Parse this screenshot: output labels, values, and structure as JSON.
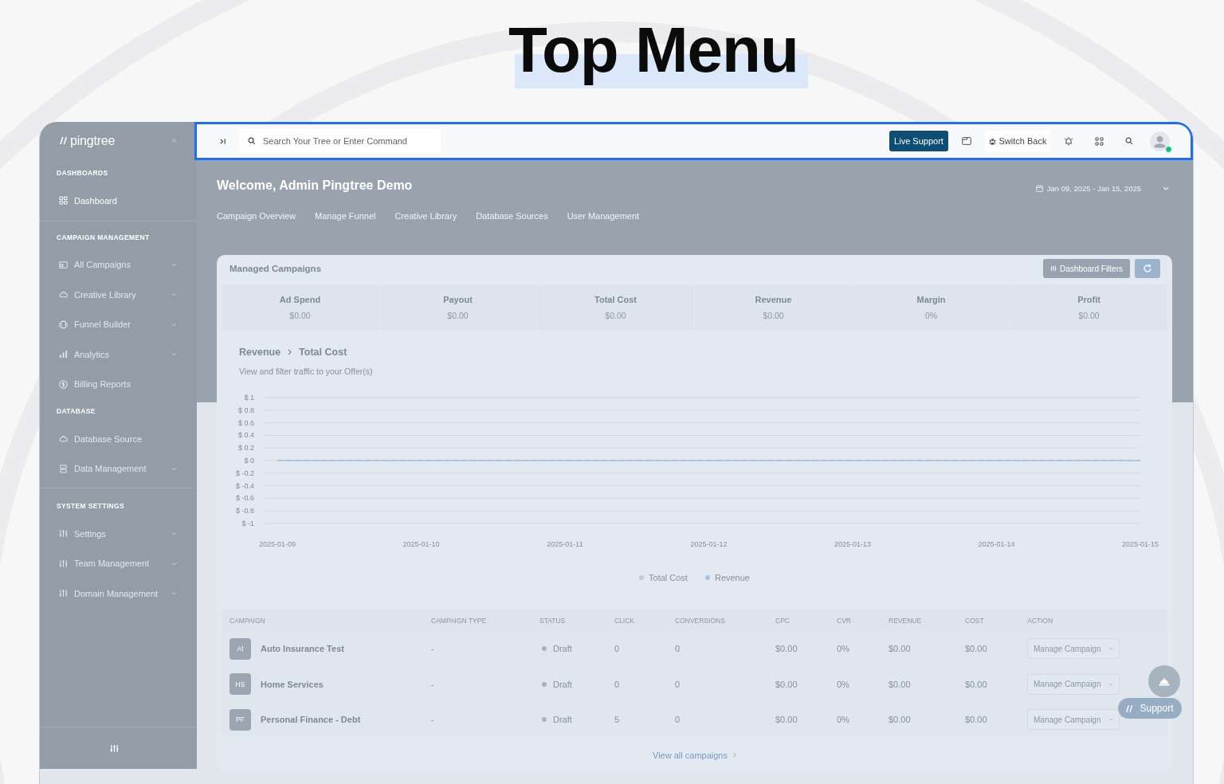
{
  "title": {
    "text": "Top Menu"
  },
  "sidebar": {
    "logo": "pingtree",
    "sections": [
      {
        "heading": "DASHBOARDS",
        "items": [
          {
            "label": "Dashboard",
            "kind": "link",
            "selected": true
          }
        ]
      },
      {
        "heading": "CAMPAIGN MANAGEMENT",
        "items": [
          {
            "label": "All Campaigns",
            "kind": "menu",
            "selected": false
          },
          {
            "label": "Creative Library",
            "kind": "menu",
            "selected": false
          },
          {
            "label": "Funnel Builder",
            "kind": "menu",
            "selected": false
          },
          {
            "label": "Analytics",
            "kind": "menu",
            "selected": false
          },
          {
            "label": "Billing Reports",
            "kind": "link",
            "selected": false
          }
        ]
      },
      {
        "heading": "DATABASE",
        "items": [
          {
            "label": "Database Source",
            "kind": "link",
            "selected": false
          },
          {
            "label": "Data Management",
            "kind": "menu",
            "selected": false
          }
        ]
      },
      {
        "heading": "SYSTEM SETTINGS",
        "items": [
          {
            "label": "Settings",
            "kind": "menu",
            "selected": false
          },
          {
            "label": "Team Management",
            "kind": "menu",
            "selected": false
          },
          {
            "label": "Domain Management",
            "kind": "menu",
            "selected": false
          }
        ]
      }
    ]
  },
  "topbar": {
    "search": {
      "placeholder": "Search Your Tree or Enter Command"
    },
    "live_support_button": "Live Support",
    "switch_back_button": "Switch Back",
    "user": {
      "online": true
    }
  },
  "header": {
    "greeting": "Welcome, Admin Pingtree Demo",
    "date_range": "Jan 09, 2025 - Jan 15, 2025",
    "tabs": [
      "Campaign Overview",
      "Manage Funnel",
      "Creative Library",
      "Database Sources",
      "User Management"
    ]
  },
  "managed_campaigns": {
    "title": "Managed Campaigns",
    "filters_button": "Dashboard Filters",
    "stats": [
      {
        "label": "Ad Spend",
        "value": "$0.00"
      },
      {
        "label": "Payout",
        "value": "$0.00"
      },
      {
        "label": "Total Cost",
        "value": "$0.00"
      },
      {
        "label": "Revenue",
        "value": "$0.00"
      },
      {
        "label": "Margin",
        "value": "0%"
      },
      {
        "label": "Profit",
        "value": "$0.00"
      }
    ],
    "chart": {
      "breadcrumb": [
        "Revenue",
        "Total Cost"
      ],
      "subtitle": "View and filter traffic to your Offer(s)",
      "chart_data": {
        "type": "line",
        "categories": [
          "2025-01-09",
          "2025-01-10",
          "2025-01-11",
          "2025-01-12",
          "2025-01-13",
          "2025-01-14",
          "2025-01-15"
        ],
        "series": [
          {
            "name": "Total Cost",
            "color": "#c3c9cf",
            "line_style": "solid",
            "values": [
              0,
              0,
              0,
              0,
              0,
              0,
              0
            ]
          },
          {
            "name": "Revenue",
            "color": "#a9c2e6",
            "line_style": "dashed",
            "values": [
              0,
              0,
              0,
              0,
              0,
              0,
              0
            ]
          }
        ],
        "ylim": [
          -1,
          1
        ],
        "yticks": [
          {
            "value": 1,
            "label": "$ 1"
          },
          {
            "value": 0.8,
            "label": "$ 0.8"
          },
          {
            "value": 0.6,
            "label": "$ 0.6"
          },
          {
            "value": 0.4,
            "label": "$ 0.4"
          },
          {
            "value": 0.2,
            "label": "$ 0.2"
          },
          {
            "value": 0,
            "label": "$ 0"
          },
          {
            "value": -0.2,
            "label": "$ -0.2"
          },
          {
            "value": -0.4,
            "label": "$ -0.4"
          },
          {
            "value": -0.6,
            "label": "$ -0.6"
          },
          {
            "value": -0.8,
            "label": "$ -0.8"
          },
          {
            "value": -1,
            "label": "$ -1"
          }
        ],
        "grid": true,
        "legend": "bottom"
      }
    },
    "table": {
      "columns": [
        "CAMPAIGN",
        "CAMPAIGN TYPE",
        "STATUS",
        "CLICK",
        "CONVERSIONS",
        "CPC",
        "CVR",
        "REVENUE",
        "COST",
        "ACTION"
      ],
      "rows": [
        {
          "initials": "AI",
          "campaign": "Auto Insurance Test",
          "type": "-",
          "status": "Draft",
          "click": "0",
          "conversions": "0",
          "cpc": "$0.00",
          "cvr": "0%",
          "revenue": "$0.00",
          "cost": "$0.00",
          "action": "Manage Campaign"
        },
        {
          "initials": "HS",
          "campaign": "Home Services",
          "type": "-",
          "status": "Draft",
          "click": "0",
          "conversions": "0",
          "cpc": "$0.00",
          "cvr": "0%",
          "revenue": "$0.00",
          "cost": "$0.00",
          "action": "Manage Campaign"
        },
        {
          "initials": "PF",
          "campaign": "Personal Finance - Debt",
          "type": "-",
          "status": "Draft",
          "click": "5",
          "conversions": "0",
          "cpc": "$0.00",
          "cvr": "0%",
          "revenue": "$0.00",
          "cost": "$0.00",
          "action": "Manage Campaign"
        }
      ]
    },
    "view_all_link": "View all campaigns"
  },
  "support_widget": {
    "label": "Support"
  }
}
